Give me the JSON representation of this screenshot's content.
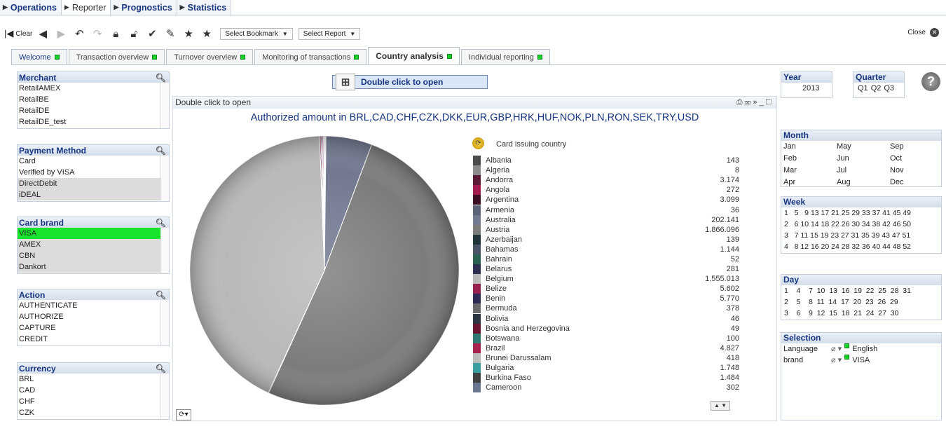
{
  "topnav": [
    {
      "label": "Operations",
      "active": false
    },
    {
      "label": "Reporter",
      "active": true
    },
    {
      "label": "Prognostics",
      "active": false
    },
    {
      "label": "Statistics",
      "active": false
    }
  ],
  "toolbar": {
    "clear_label": "Clear",
    "bookmark_select": "Select Bookmark",
    "report_select": "Select Report",
    "close_label": "Close"
  },
  "tabs": [
    {
      "label": "Welcome",
      "active": false
    },
    {
      "label": "Transaction overview",
      "active": false
    },
    {
      "label": "Turnover overview",
      "active": false
    },
    {
      "label": "Monitoring of transactions",
      "active": false
    },
    {
      "label": "Country analysis",
      "active": true
    },
    {
      "label": "Individual reporting",
      "active": false
    }
  ],
  "listboxes": {
    "merchant": {
      "title": "Merchant",
      "items": [
        "RetailAMEX",
        "RetailBE",
        "RetailDE",
        "RetailDE_test"
      ]
    },
    "payment_method": {
      "title": "Payment Method",
      "items": [
        "Card",
        "Verified by VISA",
        "DirectDebit",
        "iDEAL"
      ]
    },
    "card_brand": {
      "title": "Card brand",
      "items": [
        "VISA",
        "AMEX",
        "CBN",
        "Dankort"
      ]
    },
    "action": {
      "title": "Action",
      "items": [
        "AUTHENTICATE",
        "AUTHORIZE",
        "CAPTURE",
        "CREDIT"
      ]
    },
    "currency": {
      "title": "Currency",
      "items": [
        "BRL",
        "CAD",
        "CHF",
        "CZK"
      ]
    }
  },
  "open_button": "Double click to open",
  "chart_header": "Double click to open",
  "chart_data": {
    "type": "pie",
    "title": "Authorized amount in BRL,CAD,CHF,CZK,DKK,EUR,GBP,HRK,HUF,NOK,PLN,RON,SEK,TRY,USD",
    "legend_title": "Card issuing country",
    "legend_placement": "right",
    "slices": [
      {
        "label": "Albania",
        "value": 143,
        "display": "143",
        "color": "#4a4a4a"
      },
      {
        "label": "Algeria",
        "value": 8,
        "display": "8",
        "color": "#8c8c8c"
      },
      {
        "label": "Andorra",
        "value": 3174,
        "display": "3.174",
        "color": "#5a1a36"
      },
      {
        "label": "Angola",
        "value": 272,
        "display": "272",
        "color": "#a31b4e"
      },
      {
        "label": "Argentina",
        "value": 3099,
        "display": "3.099",
        "color": "#3b0d22"
      },
      {
        "label": "Armenia",
        "value": 36,
        "display": "36",
        "color": "#5e6478"
      },
      {
        "label": "Australia",
        "value": 202141,
        "display": "202.141",
        "color": "#727990"
      },
      {
        "label": "Austria",
        "value": 1866096,
        "display": "1.866.096",
        "color": "#7c7c7c"
      },
      {
        "label": "Azerbaijan",
        "value": 139,
        "display": "139",
        "color": "#1f3338"
      },
      {
        "label": "Bahamas",
        "value": 1144,
        "display": "1.144",
        "color": "#4a5466"
      },
      {
        "label": "Bahrain",
        "value": 52,
        "display": "52",
        "color": "#2a6152"
      },
      {
        "label": "Belarus",
        "value": 281,
        "display": "281",
        "color": "#2e2e52"
      },
      {
        "label": "Belgium",
        "value": 1555013,
        "display": "1.555.013",
        "color": "#b9b9b9"
      },
      {
        "label": "Belize",
        "value": 5602,
        "display": "5.602",
        "color": "#98204e"
      },
      {
        "label": "Benin",
        "value": 5770,
        "display": "5.770",
        "color": "#2b2a52"
      },
      {
        "label": "Bermuda",
        "value": 378,
        "display": "378",
        "color": "#6a6a6a"
      },
      {
        "label": "Bolivia",
        "value": 46,
        "display": "46",
        "color": "#2c3440"
      },
      {
        "label": "Bosnia and Herzegovina",
        "value": 49,
        "display": "49",
        "color": "#6a1530"
      },
      {
        "label": "Botswana",
        "value": 100,
        "display": "100",
        "color": "#2e7a72"
      },
      {
        "label": "Brazil",
        "value": 4827,
        "display": "4.827",
        "color": "#a8204f"
      },
      {
        "label": "Brunei Darussalam",
        "value": 418,
        "display": "418",
        "color": "#bcbcbc"
      },
      {
        "label": "Bulgaria",
        "value": 1748,
        "display": "1.748",
        "color": "#3a9fa0"
      },
      {
        "label": "Burkina Faso",
        "value": 1484,
        "display": "1.484",
        "color": "#3f3f3f"
      },
      {
        "label": "Cameroon",
        "value": 302,
        "display": "302",
        "color": "#6a7690"
      }
    ]
  },
  "right": {
    "year": {
      "title": "Year",
      "value": "2013"
    },
    "quarter": {
      "title": "Quarter",
      "items": [
        "Q1",
        "Q2",
        "Q3"
      ]
    },
    "month": {
      "title": "Month",
      "items": [
        "Jan",
        "May",
        "Sep",
        "Feb",
        "Jun",
        "Oct",
        "Mar",
        "Jul",
        "Nov",
        "Apr",
        "Aug",
        "Dec"
      ]
    },
    "week": {
      "title": "Week",
      "rows": [
        "1   5   9 13 17 21 25 29 33 37 41 45 49",
        "2   6 10 14 18 22 26 30 34 38 42 46 50",
        "3   7 11 15 19 23 27 31 35 39 43 47 51",
        "4   8 12 16 20 24 28 32 36 40 44 48 52"
      ]
    },
    "day": {
      "title": "Day",
      "rows": [
        "1    4    7  10  13  16  19  22  25  28  31",
        "2    5    8  11  14  17  20  23  26  29",
        "3    6    9  12  15  18  21  24  27  30"
      ]
    },
    "selection": {
      "title": "Selection",
      "rows": [
        {
          "field": "Language",
          "value": "English"
        },
        {
          "field": "brand",
          "value": "VISA"
        }
      ]
    }
  },
  "colors": {
    "accent": "#173580",
    "selected": "#18e32d",
    "led": "#18d22a"
  }
}
